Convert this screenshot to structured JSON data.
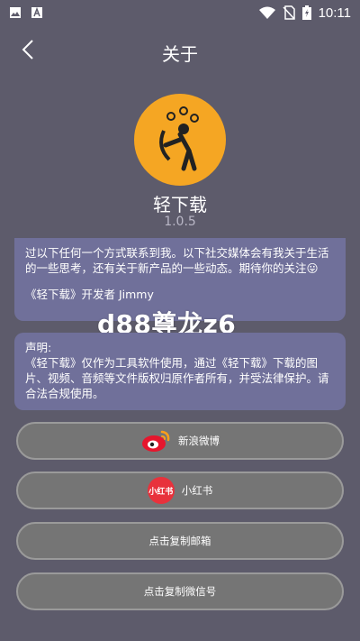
{
  "status_bar": {
    "time": "10:11",
    "icons": [
      "image-icon",
      "text-a-icon",
      "wifi-icon",
      "no-sim-icon",
      "battery-charging-icon"
    ]
  },
  "topbar": {
    "title": "关于",
    "back_icon": "chevron-left-icon"
  },
  "app": {
    "name": "轻下载",
    "version": "1.0.5",
    "logo_icon": "music-archer-logo"
  },
  "card1": {
    "text": "过以下任何一个方式联系到我。以下社交媒体会有我关于生活的一些思考，还有关于新产品的一些动态。期待你的关注😛",
    "signature": "《轻下载》开发者 Jimmy"
  },
  "watermark": "d88尊龙z6",
  "card2": {
    "title": "声明:",
    "text": "《轻下载》仅作为工具软件使用，通过《轻下载》下载的图片、视频、音频等文件版权归原作者所有，并受法律保护。请合法合规使用。"
  },
  "buttons": {
    "weibo": "新浪微博",
    "xiaohongshu": "小红书",
    "xiaohongshu_badge": "小红书",
    "copy_email": "点击复制邮箱",
    "copy_wechat": "点击复制微信号"
  },
  "colors": {
    "background": "#5d5b6b",
    "card": "#70709a",
    "button": "#757575",
    "logo": "#f5a623"
  }
}
